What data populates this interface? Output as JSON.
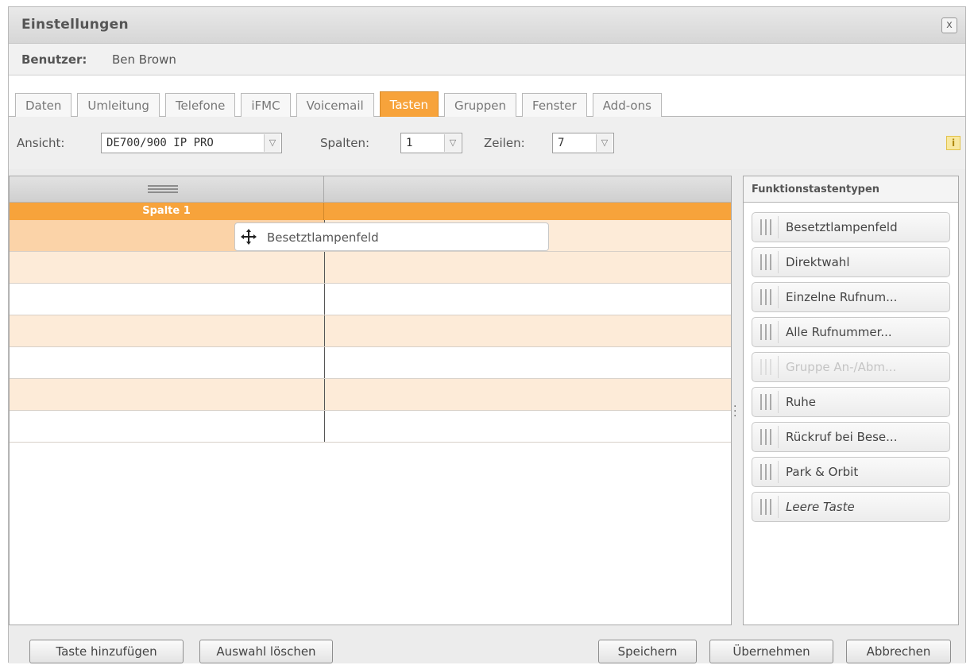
{
  "window": {
    "title": "Einstellungen",
    "close_glyph": "x"
  },
  "user": {
    "label": "Benutzer:",
    "name": "Ben Brown"
  },
  "tabs": [
    {
      "label": "Daten",
      "active": false
    },
    {
      "label": "Umleitung",
      "active": false
    },
    {
      "label": "Telefone",
      "active": false
    },
    {
      "label": "iFMC",
      "active": false
    },
    {
      "label": "Voicemail",
      "active": false
    },
    {
      "label": "Tasten",
      "active": true
    },
    {
      "label": "Gruppen",
      "active": false
    },
    {
      "label": "Fenster",
      "active": false
    },
    {
      "label": "Add-ons",
      "active": false
    }
  ],
  "toolbar": {
    "view_label": "Ansicht:",
    "view_value": "DE700/900 IP PRO",
    "columns_label": "Spalten:",
    "columns_value": "1",
    "rows_label": "Zeilen:",
    "rows_value": "7",
    "info_glyph": "i"
  },
  "grid": {
    "column_header": "Spalte 1",
    "rows": 7,
    "dragged_item": "Besetztlampenfeld"
  },
  "palette": {
    "title": "Funktionstastentypen",
    "items": [
      {
        "label": "Besetztlampenfeld",
        "disabled": false,
        "italic": false
      },
      {
        "label": "Direktwahl",
        "disabled": false,
        "italic": false
      },
      {
        "label": "Einzelne Rufnum...",
        "disabled": false,
        "italic": false
      },
      {
        "label": "Alle Rufnummer...",
        "disabled": false,
        "italic": false
      },
      {
        "label": "Gruppe An-/Abm...",
        "disabled": true,
        "italic": false
      },
      {
        "label": "Ruhe",
        "disabled": false,
        "italic": false
      },
      {
        "label": "Rückruf bei Bese...",
        "disabled": false,
        "italic": false
      },
      {
        "label": "Park & Orbit",
        "disabled": false,
        "italic": false
      },
      {
        "label": "Leere Taste",
        "disabled": false,
        "italic": true
      }
    ]
  },
  "footer": {
    "add_key": "Taste hinzufügen",
    "clear_selection": "Auswahl löschen",
    "save": "Speichern",
    "apply": "Übernehmen",
    "cancel": "Abbrechen"
  },
  "colors": {
    "accent": "#f7a33b",
    "row_tint": "#fdebd8"
  },
  "icons": [
    "close-icon",
    "chevron-down-icon",
    "info-icon",
    "move-icon",
    "drag-grip-icon"
  ]
}
